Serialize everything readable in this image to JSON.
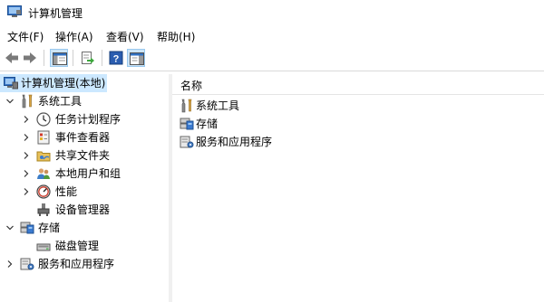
{
  "window": {
    "title": "计算机管理"
  },
  "menu": [
    {
      "label": "文件(F)"
    },
    {
      "label": "操作(A)"
    },
    {
      "label": "查看(V)"
    },
    {
      "label": "帮助(H)"
    }
  ],
  "toolbar": {
    "buttons": [
      "back-icon",
      "forward-icon",
      "show-hide-tree-icon",
      "export-list-icon",
      "help-icon",
      "properties-icon"
    ]
  },
  "tree": {
    "root": {
      "label": "计算机管理(本地)",
      "icon": "computer-management-icon"
    },
    "system_tools": {
      "label": "系统工具",
      "icon": "tools-icon"
    },
    "task_scheduler": {
      "label": "任务计划程序",
      "icon": "clock-icon"
    },
    "event_viewer": {
      "label": "事件查看器",
      "icon": "event-log-icon"
    },
    "shared_folders": {
      "label": "共享文件夹",
      "icon": "shared-folder-icon"
    },
    "local_users": {
      "label": "本地用户和组",
      "icon": "users-icon"
    },
    "performance": {
      "label": "性能",
      "icon": "performance-icon"
    },
    "device_manager": {
      "label": "设备管理器",
      "icon": "device-manager-icon"
    },
    "storage": {
      "label": "存储",
      "icon": "storage-icon"
    },
    "disk_management": {
      "label": "磁盘管理",
      "icon": "disk-icon"
    },
    "services_apps": {
      "label": "服务和应用程序",
      "icon": "services-icon"
    }
  },
  "list": {
    "column_header": "名称",
    "items": [
      {
        "label": "系统工具",
        "icon": "tools-icon"
      },
      {
        "label": "存储",
        "icon": "storage-icon"
      },
      {
        "label": "服务和应用程序",
        "icon": "services-icon"
      }
    ]
  },
  "colors": {
    "selected_row": "#cce8ff",
    "pressed_button": "#cce4f7"
  }
}
